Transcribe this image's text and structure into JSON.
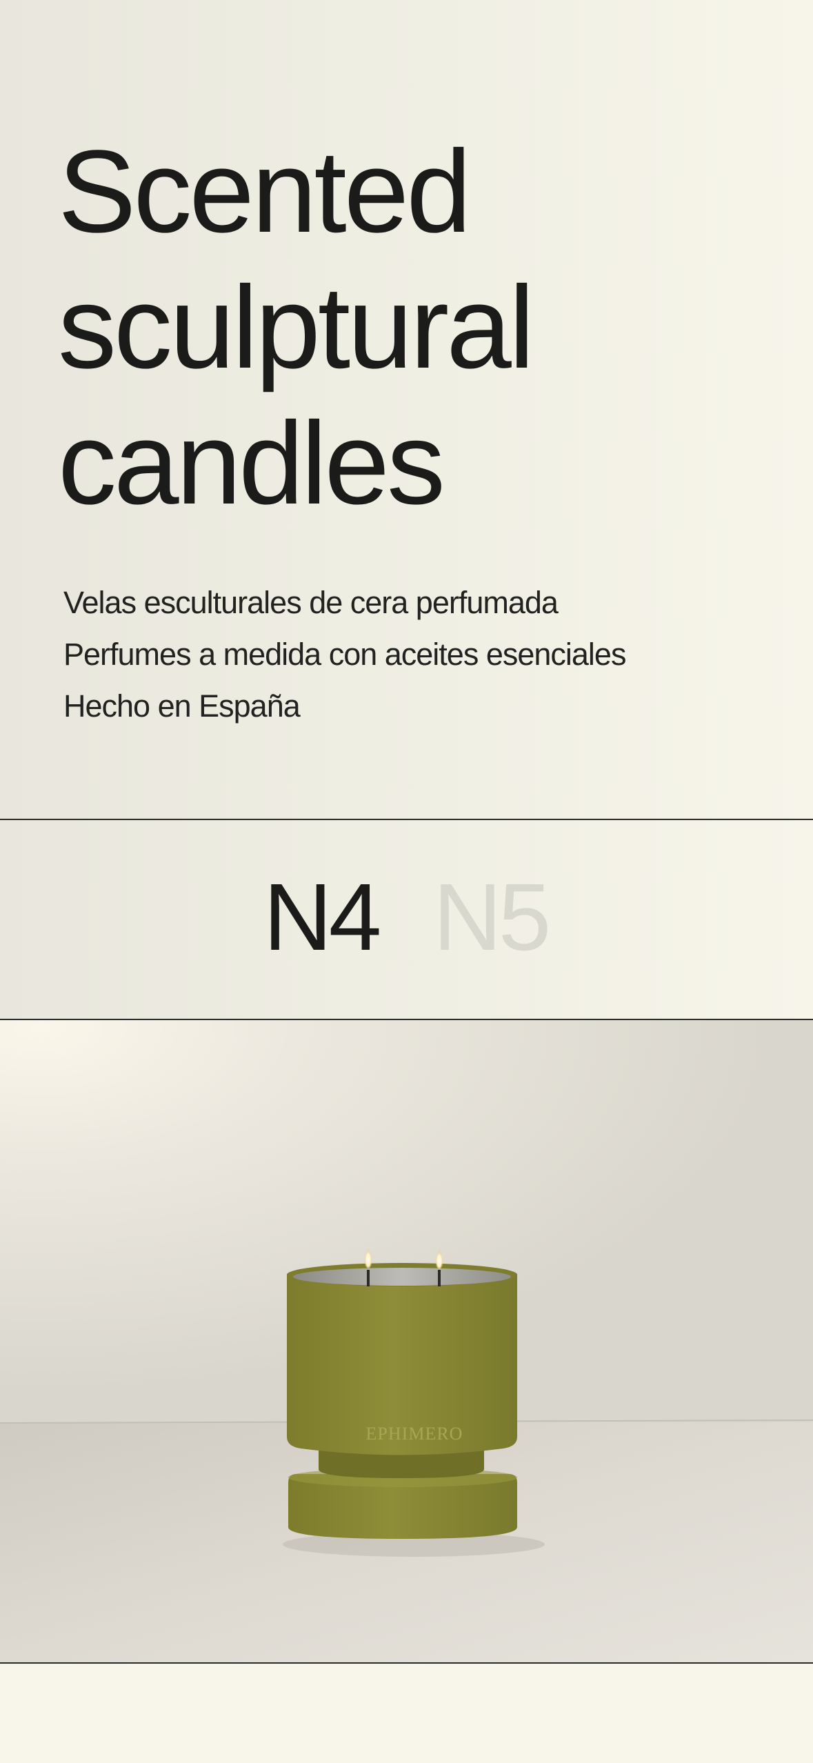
{
  "hero": {
    "title_lines": [
      "Scented",
      "sculptural",
      "candles"
    ],
    "tagline": [
      "Velas esculturales de cera perfumada",
      "Perfumes a medida con aceites esenciales",
      "Hecho en España"
    ]
  },
  "variants": {
    "tabs": [
      {
        "label": "N4",
        "active": true
      },
      {
        "label": "N5",
        "active": false
      }
    ]
  },
  "product": {
    "brand_mark": "EPHIMERO",
    "candle_color": "#8a8a33"
  }
}
